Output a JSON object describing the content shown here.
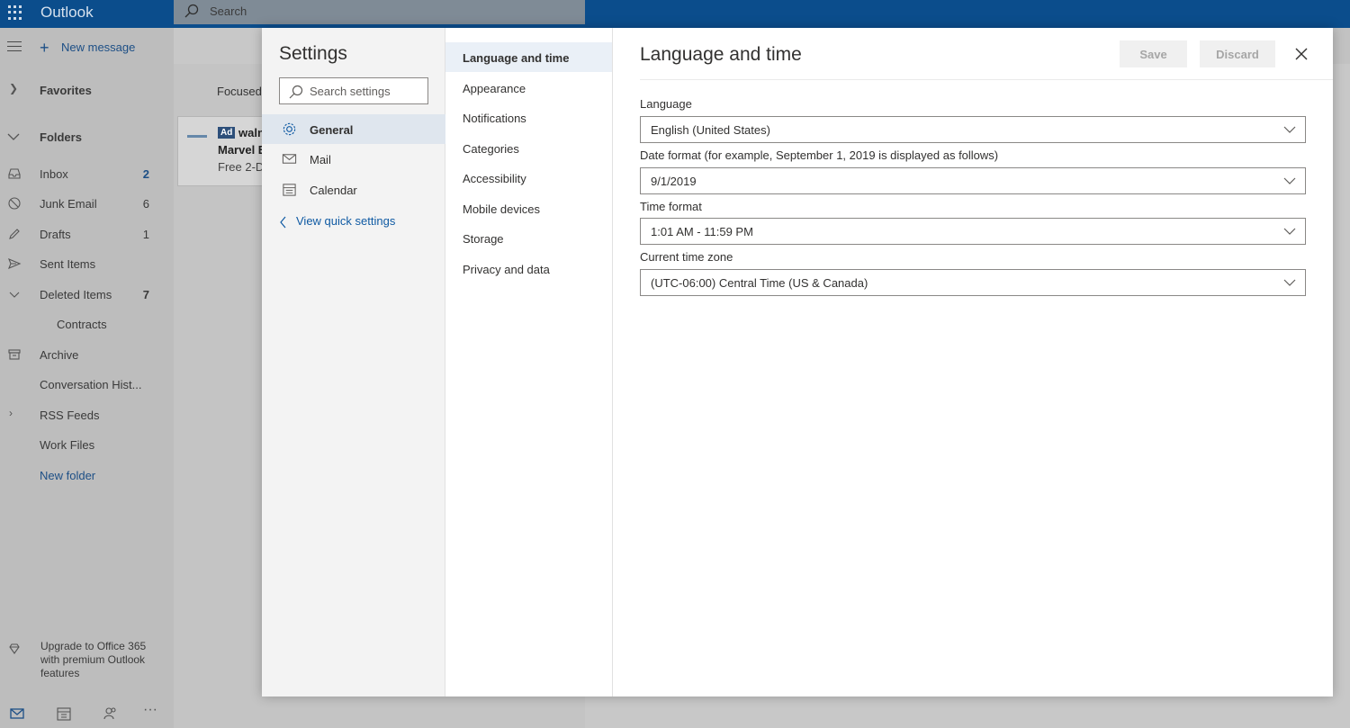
{
  "app": {
    "title": "Outlook",
    "search_placeholder": "Search"
  },
  "nav": {
    "new_message": "New message",
    "favorites": "Favorites",
    "folders": "Folders",
    "items": [
      {
        "label": "Inbox",
        "count": "2"
      },
      {
        "label": "Junk Email",
        "count": "6"
      },
      {
        "label": "Drafts",
        "count": "1"
      },
      {
        "label": "Sent Items",
        "count": ""
      },
      {
        "label": "Deleted Items",
        "count": "7"
      },
      {
        "label": "Contracts",
        "count": ""
      },
      {
        "label": "Archive",
        "count": ""
      },
      {
        "label": "Conversation Hist...",
        "count": ""
      },
      {
        "label": "RSS Feeds",
        "count": ""
      },
      {
        "label": "Work Files",
        "count": ""
      },
      {
        "label": "New folder",
        "count": ""
      }
    ],
    "upgrade": "Upgrade to Office 365 with premium Outlook features"
  },
  "message_list": {
    "tab": "Focused",
    "card": {
      "badge": "Ad",
      "sender": "waln",
      "subject": "Marvel E",
      "preview": "Free 2-D"
    }
  },
  "settings": {
    "title": "Settings",
    "search_placeholder": "Search settings",
    "categories": [
      {
        "label": "General",
        "icon": "gear-icon",
        "active": true
      },
      {
        "label": "Mail",
        "icon": "mail-icon",
        "active": false
      },
      {
        "label": "Calendar",
        "icon": "calendar-icon",
        "active": false
      }
    ],
    "quick_link": "View quick settings",
    "subcategories": [
      {
        "label": "Language and time",
        "active": true
      },
      {
        "label": "Appearance",
        "active": false
      },
      {
        "label": "Notifications",
        "active": false
      },
      {
        "label": "Categories",
        "active": false
      },
      {
        "label": "Accessibility",
        "active": false
      },
      {
        "label": "Mobile devices",
        "active": false
      },
      {
        "label": "Storage",
        "active": false
      },
      {
        "label": "Privacy and data",
        "active": false
      }
    ],
    "panel": {
      "heading": "Language and time",
      "save": "Save",
      "discard": "Discard",
      "fields": [
        {
          "label": "Language",
          "value": "English (United States)"
        },
        {
          "label": "Date format (for example, September 1, 2019 is displayed as follows)",
          "value": "9/1/2019"
        },
        {
          "label": "Time format",
          "value": "1:01 AM - 11:59 PM"
        },
        {
          "label": "Current time zone",
          "value": "(UTC-06:00) Central Time (US & Canada)"
        }
      ]
    }
  },
  "colors": {
    "topbar": "#0b4d8c",
    "accent": "#1d4f86",
    "link": "#0f5aa3"
  }
}
